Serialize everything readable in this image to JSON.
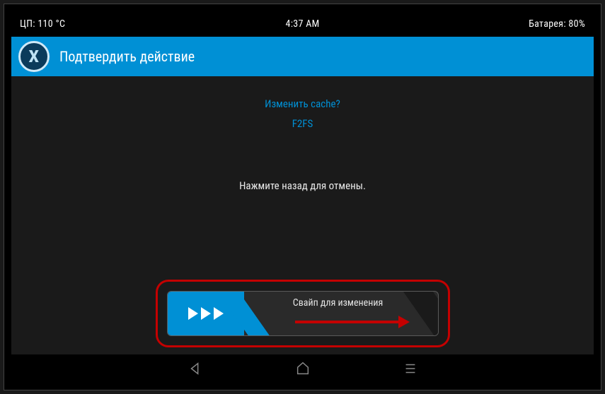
{
  "status": {
    "cpu": "ЦП: 110 °C",
    "time": "4:37 AM",
    "battery": "Батарея: 80%"
  },
  "header": {
    "title": "Подтвердить действие"
  },
  "content": {
    "question": "Изменить cache?",
    "fs": "F2FS",
    "instruction": "Нажмите назад для отмены."
  },
  "swipe": {
    "label": "Свайп для изменения"
  },
  "nav": {
    "back": "back",
    "home": "home",
    "menu": "menu"
  },
  "annotation": {
    "arrow": "arrow-right"
  }
}
